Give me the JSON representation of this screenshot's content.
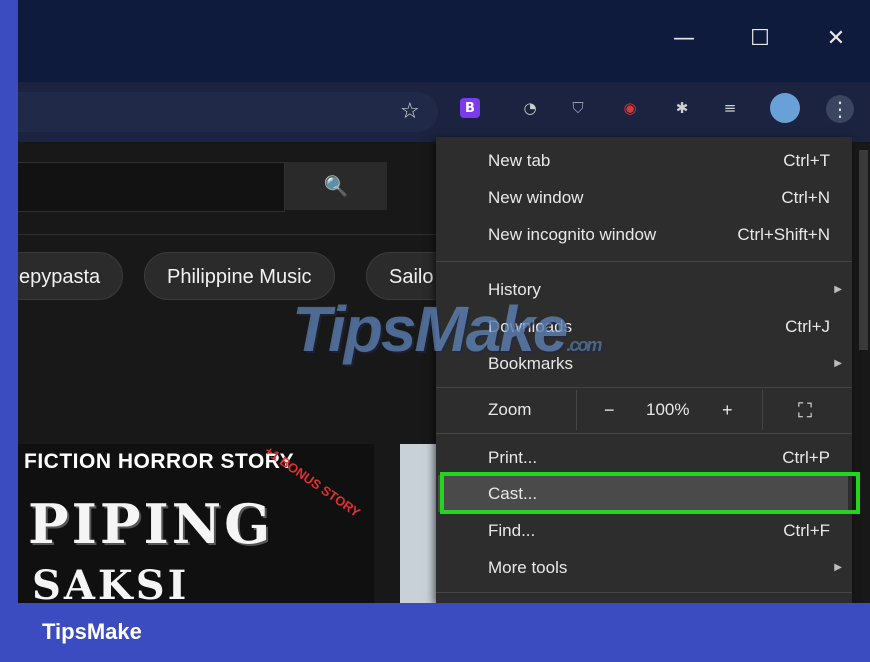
{
  "window": {
    "minimize_glyph": "—",
    "maximize_glyph": "☐",
    "close_glyph": "✕"
  },
  "toolbar": {
    "star_glyph": "☆",
    "extensions": [
      {
        "name": "bootstrap-extension-icon",
        "glyph": "B",
        "color": "#7c3aed"
      },
      {
        "name": "speed-dial-extension-icon",
        "glyph": "◔",
        "color": "#cfcfcf"
      },
      {
        "name": "shield-extension-icon",
        "glyph": "⛉",
        "color": "#9aa0b0"
      },
      {
        "name": "record-extension-icon",
        "glyph": "◉",
        "color": "#d43a3a"
      },
      {
        "name": "puzzle-extensions-icon",
        "glyph": "✱",
        "color": "#cfcfcf"
      },
      {
        "name": "media-control-icon",
        "glyph": "≡",
        "color": "#cfcfcf"
      }
    ],
    "menu_glyph": "⋮"
  },
  "youtube": {
    "search_glyph": "🔍",
    "chips": [
      "epypasta",
      "Philippine Music",
      "Sailo"
    ],
    "thumbnail": {
      "title": "FICTION HORROR STORY",
      "badge": "+1 BONUS STORY",
      "big_text": "PIPING",
      "big_text2": "SAKSI"
    }
  },
  "menu": {
    "items": [
      {
        "label": "New tab",
        "shortcut": "Ctrl+T"
      },
      {
        "label": "New window",
        "shortcut": "Ctrl+N"
      },
      {
        "label": "New incognito window",
        "shortcut": "Ctrl+Shift+N"
      },
      {
        "label": "History",
        "shortcut": ""
      },
      {
        "label": "Downloads",
        "shortcut": "Ctrl+J"
      },
      {
        "label": "Bookmarks",
        "shortcut": ""
      },
      {
        "label": "Print...",
        "shortcut": "Ctrl+P"
      },
      {
        "label": "Cast...",
        "shortcut": ""
      },
      {
        "label": "Find...",
        "shortcut": "Ctrl+F"
      },
      {
        "label": "More tools",
        "shortcut": ""
      }
    ],
    "zoom": {
      "label": "Zoom",
      "minus": "−",
      "value": "100%",
      "plus": "+",
      "fullscreen_glyph": "⛶"
    },
    "submenu_arrow": "▶"
  },
  "watermark": {
    "text": "TipsMake",
    "suffix": ".com"
  },
  "footer": {
    "brand": "TipsMake"
  },
  "colors": {
    "highlight": "#27d322",
    "frame": "#3b4cc0"
  }
}
